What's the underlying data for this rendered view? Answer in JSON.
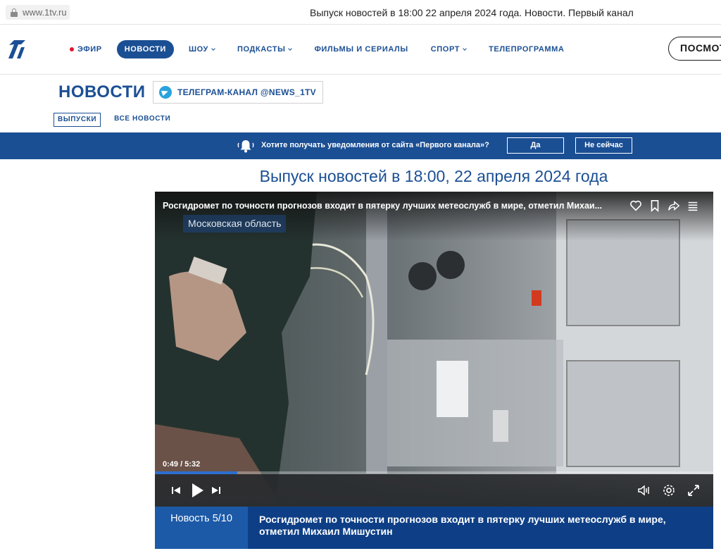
{
  "browser": {
    "url": "www.1tv.ru",
    "page_title": "Выпуск новостей в 18:00 22 апреля 2024 года. Новости. Первый канал"
  },
  "nav": {
    "items": [
      {
        "label": "ЭФИР"
      },
      {
        "label": "НОВОСТИ"
      },
      {
        "label": "ШОУ"
      },
      {
        "label": "ПОДКАСТЫ"
      },
      {
        "label": "ФИЛЬМЫ И СЕРИАЛЫ"
      },
      {
        "label": "СПОРТ"
      },
      {
        "label": "ТЕЛЕПРОГРАММА"
      }
    ],
    "watch_button": "ПОСМОТРЕТЬ"
  },
  "section": {
    "title": "НОВОСТИ",
    "telegram_label": "ТЕЛЕГРАМ-КАНАЛ @NEWS_1TV",
    "tabs": [
      {
        "label": "ВЫПУСКИ"
      },
      {
        "label": "ВСЕ НОВОСТИ"
      }
    ]
  },
  "notification": {
    "text": "Хотите получать уведомления от сайта «Первого канала»?",
    "yes": "Да",
    "no": "Не сейчас"
  },
  "headline": "Выпуск новостей в 18:00, 22 апреля 2024 года",
  "player": {
    "title": "Росгидромет по точности прогнозов входит в пятерку лучших метеослужб в мире, отметил Михаи...",
    "region": "Московская область",
    "time": "0:49 / 5:32",
    "progress": 0.147,
    "icons": [
      "heart-icon",
      "bookmark-icon",
      "share-icon",
      "menu-icon",
      "prev-icon",
      "play-icon",
      "next-icon",
      "volume-icon",
      "settings-icon",
      "fullscreen-icon"
    ]
  },
  "caption": {
    "number": "Новость 5/10",
    "text": "Росгидромет по точности прогнозов входит в пятерку лучших метеослужб в мире, отметил Михаил Мишустин"
  },
  "colors": {
    "brand_blue": "#1b4f94",
    "live_red": "#e4142d",
    "caption_dark": "#0e3f86",
    "caption_light": "#1c5aa8",
    "progress_blue": "#2d6fd0",
    "telegram_blue": "#2aa3dd"
  }
}
